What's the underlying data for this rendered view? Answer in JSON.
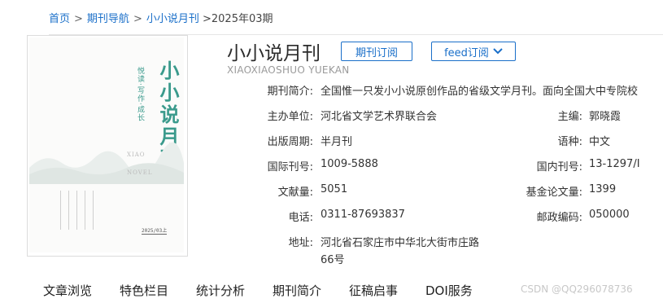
{
  "breadcrumb": {
    "home": "首页",
    "journals_nav": "期刊导航",
    "journal": "小小说月刊",
    "current": ">2025年03期",
    "sep": ">"
  },
  "cover": {
    "title": "小小说月刊",
    "subtitle": "悦读·写作·成长",
    "en_top": "XIAO",
    "en_bottom": "NOVEL",
    "issue": "2025/03上"
  },
  "journal": {
    "title": "小小说月刊",
    "pinyin": "XIAOXIAOSHUO YUEKAN",
    "subscribe_label": "期刊订阅",
    "feed_label": "feed订阅"
  },
  "info": {
    "intro_label": "期刊简介:",
    "intro_value": "全国惟一只发小小说原创作品的省级文学月刊。面向全国大中专院校",
    "sponsor_label": "主办单位:",
    "sponsor_value": "河北省文学艺术界联合会",
    "editor_label": "主编:",
    "editor_value": "郭晓霞",
    "cycle_label": "出版周期:",
    "cycle_value": "半月刊",
    "language_label": "语种:",
    "language_value": "中文",
    "issn_label": "国际刊号:",
    "issn_value": "1009-5888",
    "cn_label": "国内刊号:",
    "cn_value": "13-1297/I",
    "docs_label": "文献量:",
    "docs_value": "5051",
    "fund_label": "基金论文量:",
    "fund_value": "1399",
    "phone_label": "电话:",
    "phone_value": "0311-87693837",
    "postal_label": "邮政编码:",
    "postal_value": "050000",
    "address_label": "地址:",
    "address_line1": "河北省石家庄市中华北大街市庄路",
    "address_line2": "66号"
  },
  "tabs": [
    {
      "label": "文章浏览"
    },
    {
      "label": "特色栏目"
    },
    {
      "label": "统计分析"
    },
    {
      "label": "期刊简介"
    },
    {
      "label": "征稿启事"
    },
    {
      "label": "DOI服务"
    }
  ],
  "watermark": "CSDN @QQ296078736",
  "colors": {
    "link": "#1a6fc9",
    "cover_accent": "#3a9a8c"
  }
}
